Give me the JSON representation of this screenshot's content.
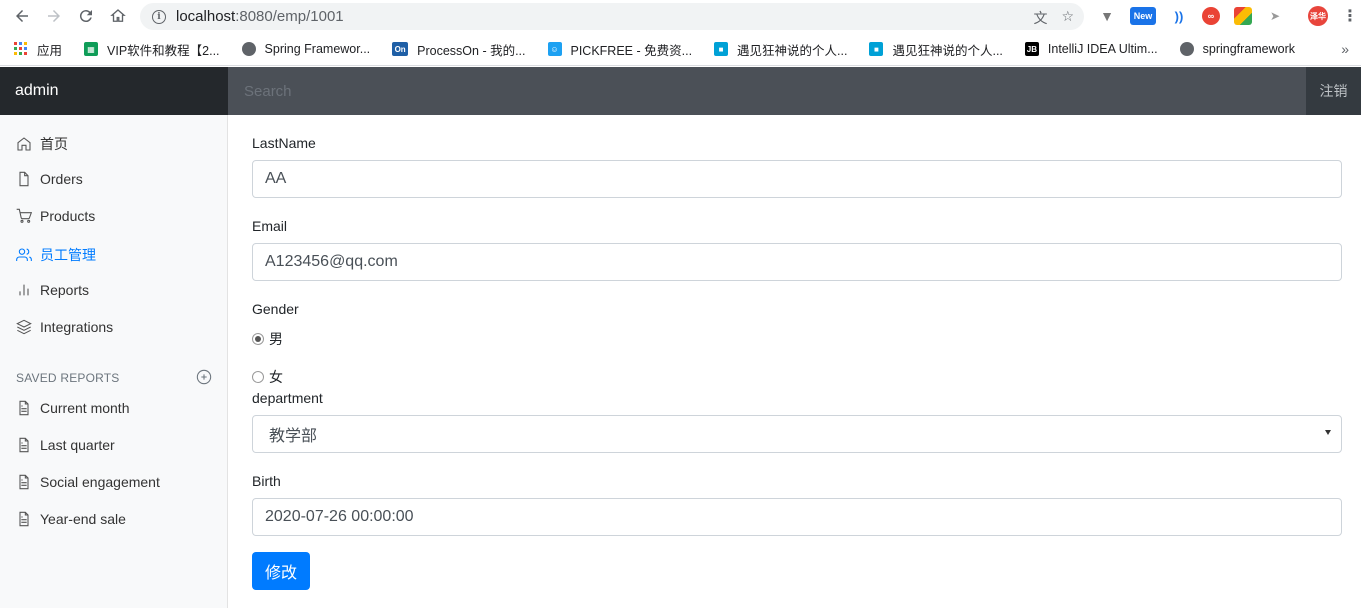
{
  "browser": {
    "url_host": "localhost",
    "url_path": ":8080/emp/1001",
    "bookmarks": [
      {
        "label": "应用",
        "icon": "apps-grid-icon",
        "color": "#4285f4"
      },
      {
        "label": "VIP软件和教程【2...",
        "icon": "sheet-icon",
        "color": "#0f9d58"
      },
      {
        "label": "Spring Framewor...",
        "icon": "globe-icon",
        "color": "#5f6368"
      },
      {
        "label": "ProcessOn - 我的...",
        "icon": "processon-icon",
        "color": "#1f5fa6"
      },
      {
        "label": "PICKFREE - 免费资...",
        "icon": "pickfree-icon",
        "color": "#1da1f2"
      },
      {
        "label": "遇见狂神说的个人...",
        "icon": "bilibili-icon",
        "color": "#00a1d6"
      },
      {
        "label": "遇见狂神说的个人...",
        "icon": "bilibili-icon",
        "color": "#00a1d6"
      },
      {
        "label": "IntelliJ IDEA Ultim...",
        "icon": "jetbrains-icon",
        "color": "#000000"
      },
      {
        "label": "springframework",
        "icon": "globe-icon",
        "color": "#5f6368"
      }
    ],
    "avatar_text": "泽华",
    "new_badge": "New"
  },
  "navbar": {
    "brand": "admin",
    "search_placeholder": "Search",
    "logout": "注销"
  },
  "sidebar": {
    "items": [
      {
        "label": "首页",
        "icon": "home-icon"
      },
      {
        "label": "Orders",
        "icon": "file-icon"
      },
      {
        "label": "Products",
        "icon": "cart-icon"
      },
      {
        "label": "员工管理",
        "icon": "users-icon",
        "active": true
      },
      {
        "label": "Reports",
        "icon": "bar-chart-icon"
      },
      {
        "label": "Integrations",
        "icon": "layers-icon"
      }
    ],
    "saved_heading": "SAVED REPORTS",
    "saved_items": [
      {
        "label": "Current month",
        "icon": "file-text-icon"
      },
      {
        "label": "Last quarter",
        "icon": "file-text-icon"
      },
      {
        "label": "Social engagement",
        "icon": "file-text-icon"
      },
      {
        "label": "Year-end sale",
        "icon": "file-text-icon"
      }
    ]
  },
  "form": {
    "lastname_label": "LastName",
    "lastname_value": "AA",
    "email_label": "Email",
    "email_value": "A123456@qq.com",
    "gender_label": "Gender",
    "gender_male": "男",
    "gender_female": "女",
    "department_label": "department",
    "department_value": "教学部",
    "birth_label": "Birth",
    "birth_value": "2020-07-26 00:00:00",
    "submit_label": "修改"
  },
  "colors": {
    "accent": "#007bff",
    "navbar": "#343a40"
  }
}
